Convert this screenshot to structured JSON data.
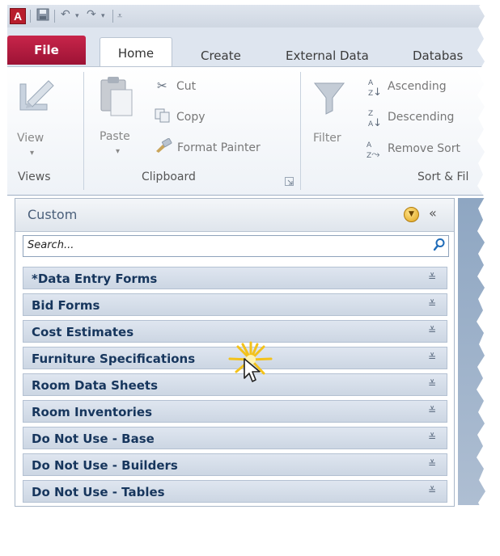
{
  "app": {
    "icon_letter": "A"
  },
  "quick_access": {
    "icons": [
      "save-icon",
      "undo-icon",
      "redo-icon",
      "customize-icon"
    ]
  },
  "tabs": {
    "file": "File",
    "home": "Home",
    "create": "Create",
    "external_data": "External Data",
    "database": "Databas"
  },
  "ribbon": {
    "views": {
      "view": "View",
      "group": "Views"
    },
    "clipboard": {
      "paste": "Paste",
      "cut": "Cut",
      "copy": "Copy",
      "format_painter": "Format Painter",
      "group": "Clipboard"
    },
    "sort_filter": {
      "filter": "Filter",
      "ascending": "Ascending",
      "descending": "Descending",
      "remove_sort": "Remove Sort",
      "group": "Sort & Fil"
    }
  },
  "nav": {
    "title": "Custom",
    "search_placeholder": "Search...",
    "groups": [
      "*Data Entry Forms",
      "Bid Forms",
      "Cost Estimates",
      "Furniture Specifications",
      "Room Data Sheets",
      "Room Inventories",
      "Do Not Use - Base",
      "Do Not Use - Builders",
      "Do Not Use - Tables"
    ]
  },
  "colors": {
    "file_tab": "#b81d3f",
    "group_text": "#17365d",
    "nav_title": "#4a5f7a",
    "shadow": "#b8b8b8"
  }
}
